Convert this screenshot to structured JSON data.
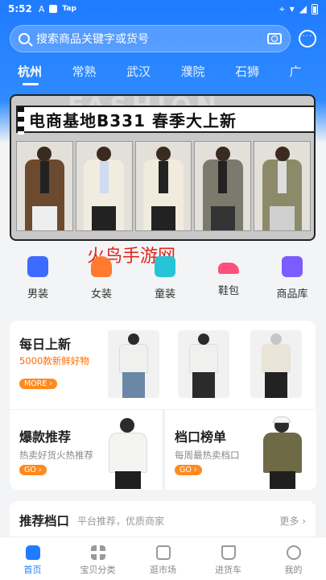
{
  "status_bar": {
    "time": "5:52",
    "tap_label": "Tap"
  },
  "search": {
    "placeholder": "搜索商品关键字或货号"
  },
  "cities": [
    "杭州",
    "常熟",
    "武汉",
    "濮院",
    "石狮",
    "广"
  ],
  "banner": {
    "title": "电商基地B331   春季大上新",
    "ghost_text": "FASHION"
  },
  "watermark": "火鸟手游网",
  "categories": [
    {
      "label": "男装",
      "icon": "menswear-icon",
      "color": "#3d6bff"
    },
    {
      "label": "女装",
      "icon": "womenswear-icon",
      "color": "#ff7a2e"
    },
    {
      "label": "童装",
      "icon": "kidswear-icon",
      "color": "#27c3d6"
    },
    {
      "label": "鞋包",
      "icon": "shoe-bag-icon",
      "color": "#ff4f7b"
    },
    {
      "label": "商品库",
      "icon": "product-library-icon",
      "color": "#7b5cff"
    }
  ],
  "daily_new": {
    "title": "每日上新",
    "subtitle": "5000款新鲜好物",
    "badge": "MORE ›"
  },
  "hot_picks": {
    "title": "爆款推荐",
    "subtitle": "热卖好货火热推荐",
    "badge": "GO ›"
  },
  "stall_rank": {
    "title": "档口榜单",
    "subtitle": "每周最热卖档口",
    "badge": "GO ›"
  },
  "recommended_stalls": {
    "title": "推荐档口",
    "subtitle": "平台推荐，优质商家",
    "more": "更多 ›"
  },
  "bottom_nav": [
    {
      "label": "首页",
      "icon": "home-icon",
      "active": true
    },
    {
      "label": "宝贝分类",
      "icon": "category-grid-icon",
      "active": false
    },
    {
      "label": "逛市场",
      "icon": "market-icon",
      "active": false
    },
    {
      "label": "进货车",
      "icon": "cart-icon",
      "active": false
    },
    {
      "label": "我的",
      "icon": "profile-icon",
      "active": false
    }
  ],
  "colors": {
    "brand_blue": "#1f7bff",
    "accent_orange": "#ff8a1f"
  }
}
